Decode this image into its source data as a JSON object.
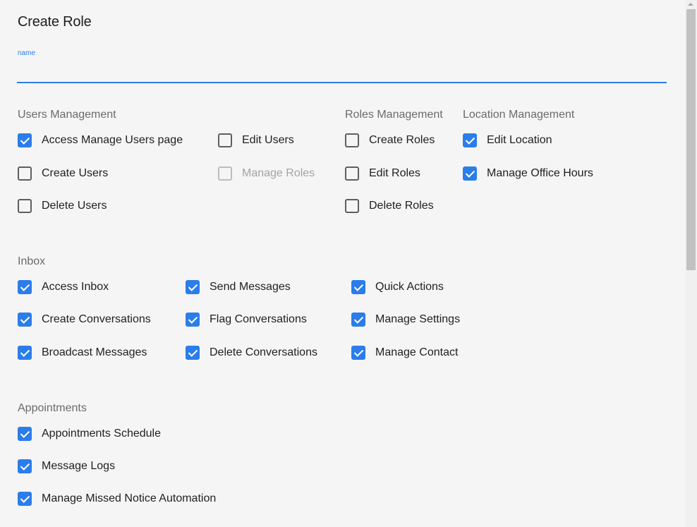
{
  "page": {
    "title": "Create Role",
    "name_field": {
      "label": "name",
      "value": "",
      "placeholder": ""
    }
  },
  "sections": {
    "users": {
      "title": "Users Management",
      "items": [
        {
          "label": "Access Manage Users page",
          "checked": true,
          "disabled": false
        },
        {
          "label": "Create Users",
          "checked": false,
          "disabled": false
        },
        {
          "label": "Delete Users",
          "checked": false,
          "disabled": false
        },
        {
          "label": "Edit Users",
          "checked": false,
          "disabled": false
        },
        {
          "label": "Manage Roles",
          "checked": false,
          "disabled": true
        }
      ]
    },
    "roles": {
      "title": "Roles Management",
      "items": [
        {
          "label": "Create Roles",
          "checked": false,
          "disabled": false
        },
        {
          "label": "Edit Roles",
          "checked": false,
          "disabled": false
        },
        {
          "label": "Delete Roles",
          "checked": false,
          "disabled": false
        }
      ]
    },
    "location": {
      "title": "Location Management",
      "items": [
        {
          "label": "Edit Location",
          "checked": true,
          "disabled": false
        },
        {
          "label": "Manage Office Hours",
          "checked": true,
          "disabled": false
        }
      ]
    },
    "inbox": {
      "title": "Inbox",
      "items": [
        {
          "label": "Access Inbox",
          "checked": true,
          "disabled": false
        },
        {
          "label": "Create Conversations",
          "checked": true,
          "disabled": false
        },
        {
          "label": "Broadcast Messages",
          "checked": true,
          "disabled": false
        },
        {
          "label": "Send Messages",
          "checked": true,
          "disabled": false
        },
        {
          "label": "Flag Conversations",
          "checked": true,
          "disabled": false
        },
        {
          "label": "Delete Conversations",
          "checked": true,
          "disabled": false
        },
        {
          "label": "Quick Actions",
          "checked": true,
          "disabled": false
        },
        {
          "label": "Manage Settings",
          "checked": true,
          "disabled": false
        },
        {
          "label": "Manage Contact",
          "checked": true,
          "disabled": false
        }
      ]
    },
    "appointments": {
      "title": "Appointments",
      "items": [
        {
          "label": "Appointments Schedule",
          "checked": true,
          "disabled": false
        },
        {
          "label": "Message Logs",
          "checked": true,
          "disabled": false
        },
        {
          "label": "Manage Missed Notice Automation",
          "checked": true,
          "disabled": false
        }
      ]
    }
  },
  "colors": {
    "accent": "#2b7de9",
    "background": "#f5f5f5",
    "section_title": "#6b6b6b",
    "disabled": "#a3a3a3"
  }
}
